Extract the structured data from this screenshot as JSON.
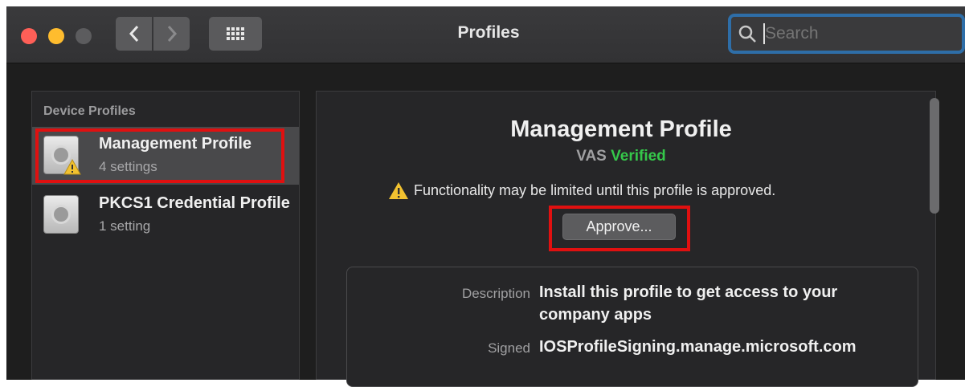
{
  "window": {
    "title": "Profiles",
    "search_placeholder": "Search"
  },
  "sidebar": {
    "header": "Device Profiles",
    "items": [
      {
        "name": "Management Profile",
        "sub": "4 settings"
      },
      {
        "name": "PKCS1 Credential Profile",
        "sub": "1 setting"
      }
    ]
  },
  "detail": {
    "title": "Management Profile",
    "vas_label": "VAS",
    "verified": "Verified",
    "notice": "Functionality may be limited until this profile is approved.",
    "approve_label": "Approve...",
    "description_label": "Description",
    "description_value": "Install this profile to get access to your company apps",
    "signed_label": "Signed",
    "signed_value": "IOSProfileSigning.manage.microsoft.com"
  },
  "colors": {
    "highlight": "#e01010",
    "verified": "#35c84a",
    "focus_ring": "#2e6ea8"
  }
}
